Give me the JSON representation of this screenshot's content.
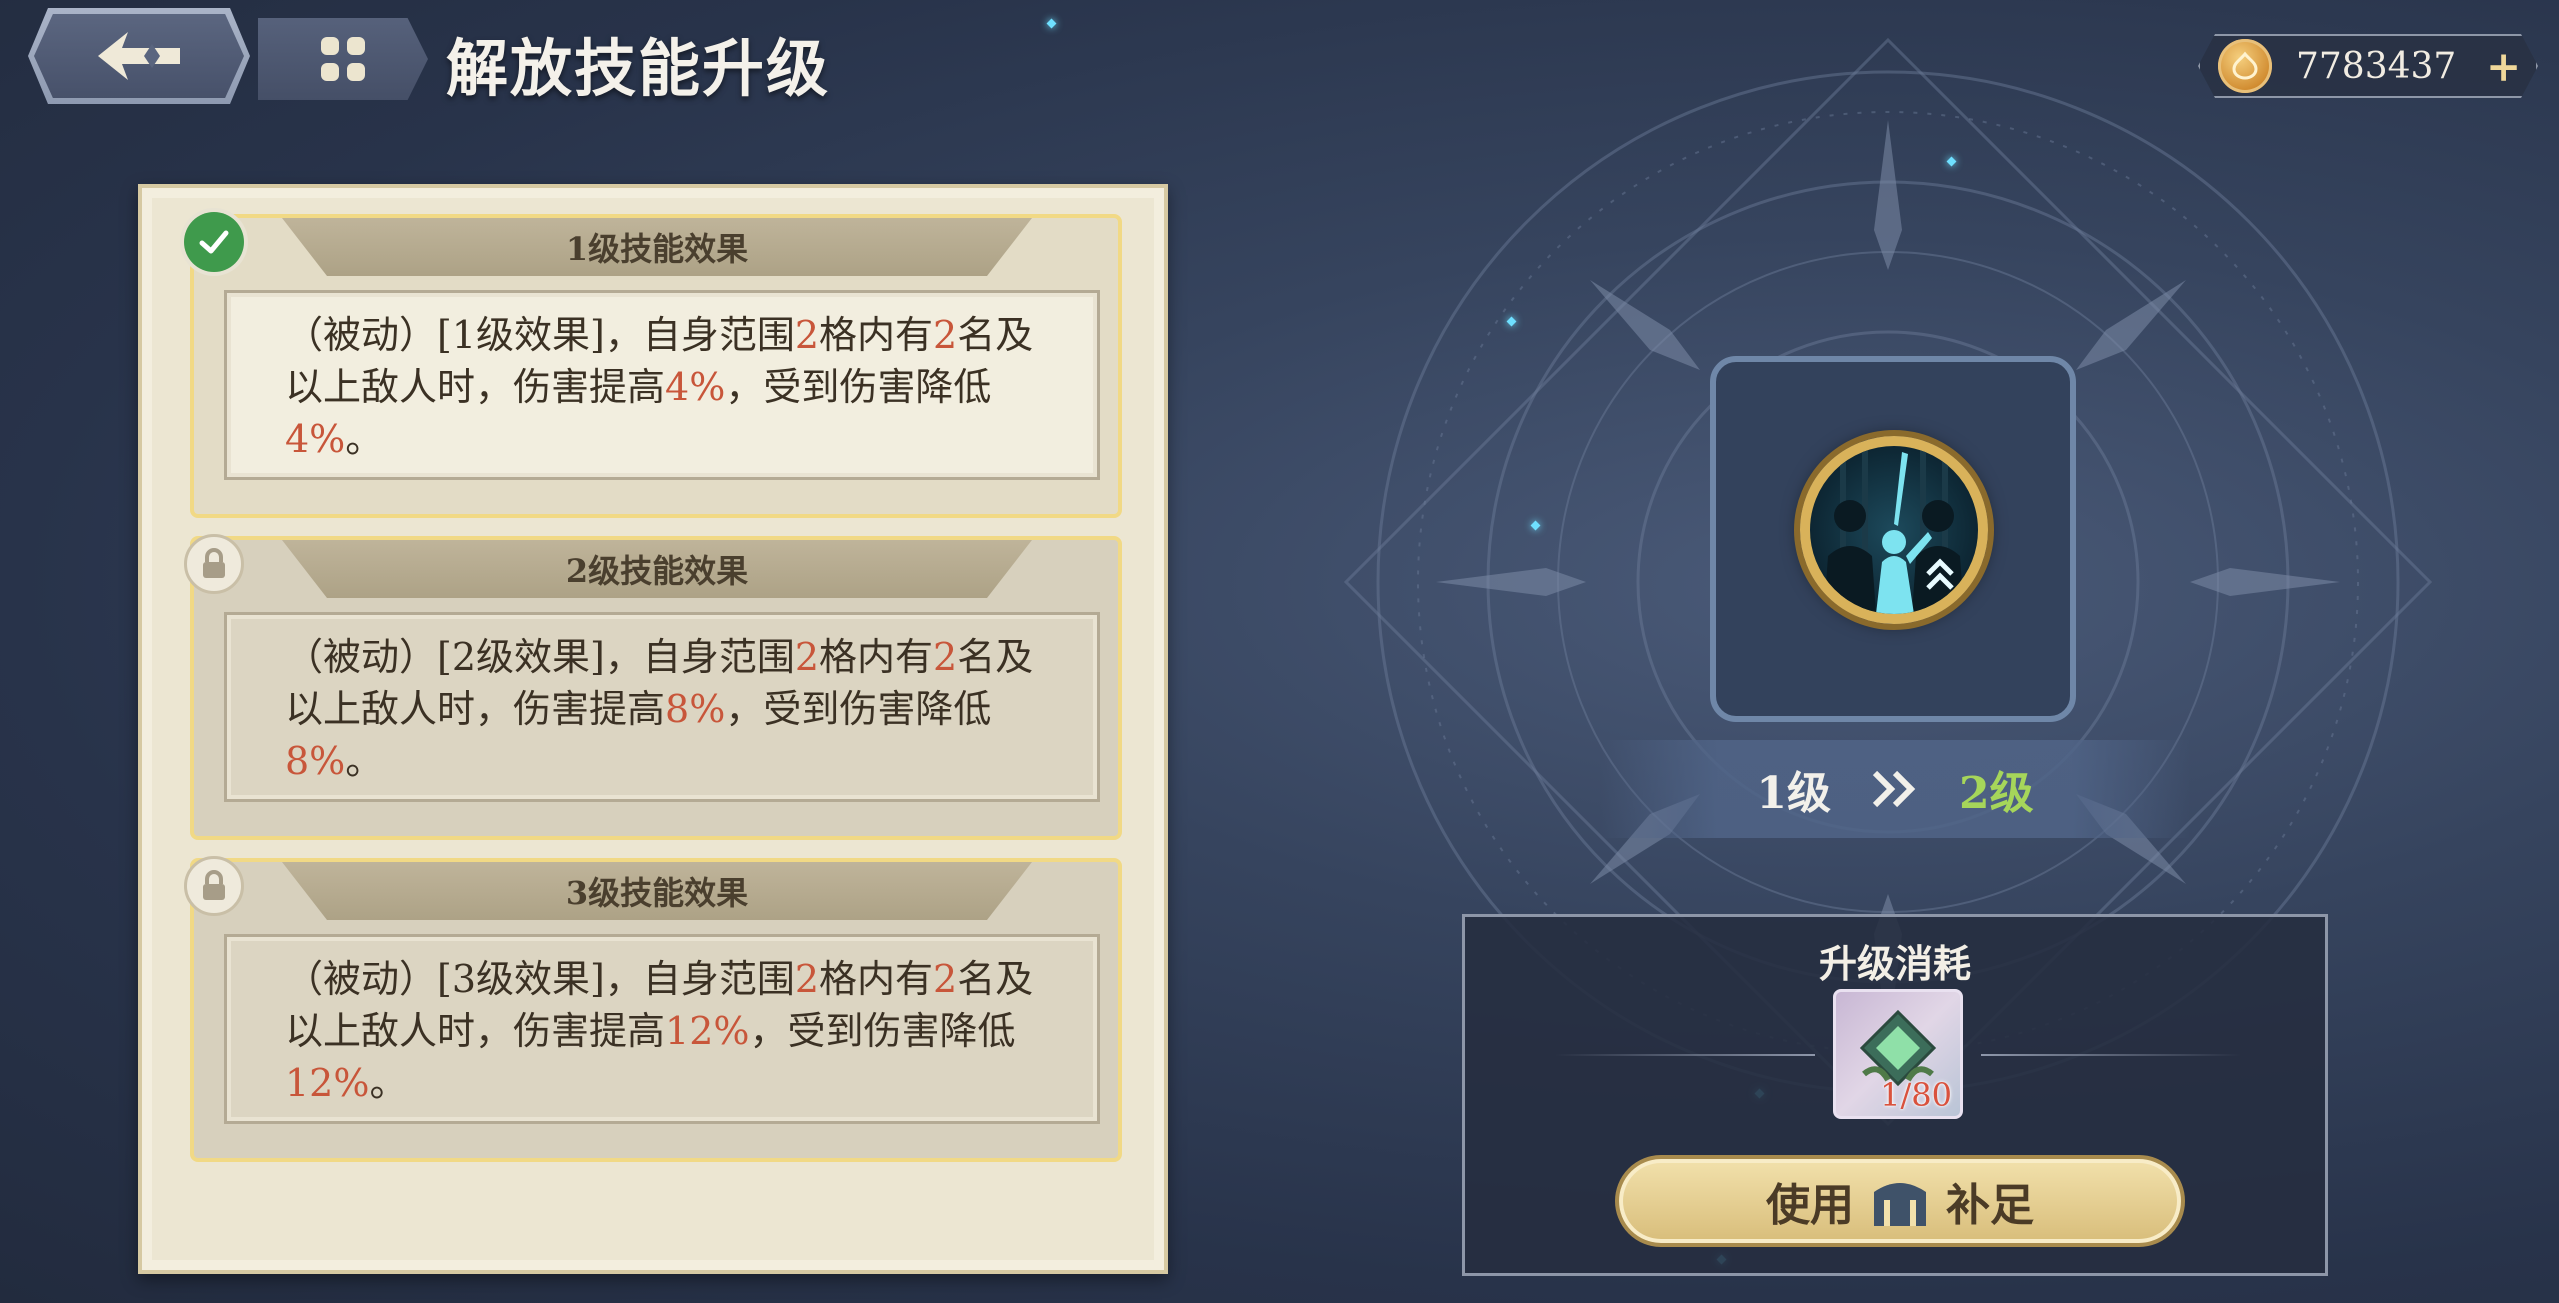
{
  "header": {
    "title": "解放技能升级"
  },
  "currency": {
    "value": "7783437",
    "plus": "+"
  },
  "effects": [
    {
      "header": "1级技能效果",
      "status": "unlocked",
      "parts": [
        {
          "t": "（被动）[1级效果]，自身范围",
          "h": false
        },
        {
          "t": "2",
          "h": true
        },
        {
          "t": "格内有",
          "h": false
        },
        {
          "t": "2",
          "h": true
        },
        {
          "t": "名及以上敌人时，伤害提高",
          "h": false
        },
        {
          "t": "4%",
          "h": true
        },
        {
          "t": "，受到伤害降低",
          "h": false
        },
        {
          "t": "4%",
          "h": true
        },
        {
          "t": "。",
          "h": false
        }
      ]
    },
    {
      "header": "2级技能效果",
      "status": "locked",
      "parts": [
        {
          "t": "（被动）[2级效果]，自身范围",
          "h": false
        },
        {
          "t": "2",
          "h": true
        },
        {
          "t": "格内有",
          "h": false
        },
        {
          "t": "2",
          "h": true
        },
        {
          "t": "名及以上敌人时，伤害提高",
          "h": false
        },
        {
          "t": "8%",
          "h": true
        },
        {
          "t": "，受到伤害降低",
          "h": false
        },
        {
          "t": "8%",
          "h": true
        },
        {
          "t": "。",
          "h": false
        }
      ]
    },
    {
      "header": "3级技能效果",
      "status": "locked",
      "parts": [
        {
          "t": "（被动）[3级效果]，自身范围",
          "h": false
        },
        {
          "t": "2",
          "h": true
        },
        {
          "t": "格内有",
          "h": false
        },
        {
          "t": "2",
          "h": true
        },
        {
          "t": "名及以上敌人时，伤害提高",
          "h": false
        },
        {
          "t": "12%",
          "h": true
        },
        {
          "t": "，受到伤害降低",
          "h": false
        },
        {
          "t": "12%",
          "h": true
        },
        {
          "t": "。",
          "h": false
        }
      ]
    }
  ],
  "level": {
    "from": "1级",
    "to": "2级"
  },
  "cost": {
    "title": "升级消耗",
    "count": "1/80",
    "button_use": "使用",
    "button_fill": "补足"
  },
  "colors": {
    "highlight": "#c8563a",
    "next_level": "#a6d65a",
    "card_border": "#f1d985",
    "check_badge": "#3f9a4c"
  }
}
